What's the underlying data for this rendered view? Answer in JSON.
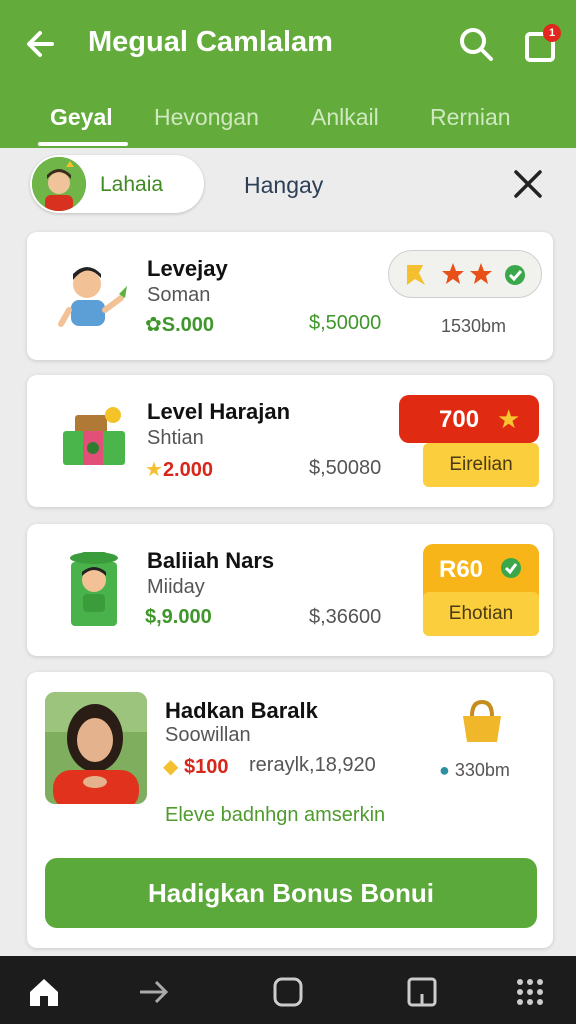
{
  "header": {
    "title": "Megual Camlalam",
    "notification_count": "1",
    "tabs": [
      {
        "label": "Geyal"
      },
      {
        "label": "Hevongan"
      },
      {
        "label": "Anlkail"
      },
      {
        "label": "Rernian"
      }
    ]
  },
  "filter": {
    "chip_label": "Lahaia",
    "alt_label": "Hangay"
  },
  "cards": [
    {
      "title": "Levejay",
      "subtitle": "Soman",
      "amount": "S.000",
      "price": "$,50000",
      "distance": "1530bm"
    },
    {
      "title": "Level Harajan",
      "subtitle": "Shtian",
      "amount": "2.000",
      "price": "$,50080",
      "badge": "700",
      "action": "Eirelian"
    },
    {
      "title": "Baliiah Nars",
      "subtitle": "Miiday",
      "amount": "$,9.000",
      "price": "$,36600",
      "badge": "R60",
      "action": "Ehotian"
    }
  ],
  "profile": {
    "name": "Hadkan Baralk",
    "subtitle": "Soowillan",
    "reward": "$100",
    "reward_note": "reraylk,18,920",
    "distance": "330bm",
    "promo": "Eleve badnhgn amserkin",
    "button": "Hadigkan Bonus Bonui"
  },
  "colors": {
    "brand_green": "#63ac3b",
    "accent_red": "#e02a12",
    "accent_yellow": "#fbce3e",
    "accent_orange": "#f8b51a"
  },
  "icons": [
    "back-arrow-icon",
    "search-icon",
    "bag-icon",
    "close-icon",
    "star-icon",
    "check-icon",
    "home-icon",
    "back-nav-icon",
    "square-nav-icon",
    "recent-icon",
    "grid-icon"
  ]
}
